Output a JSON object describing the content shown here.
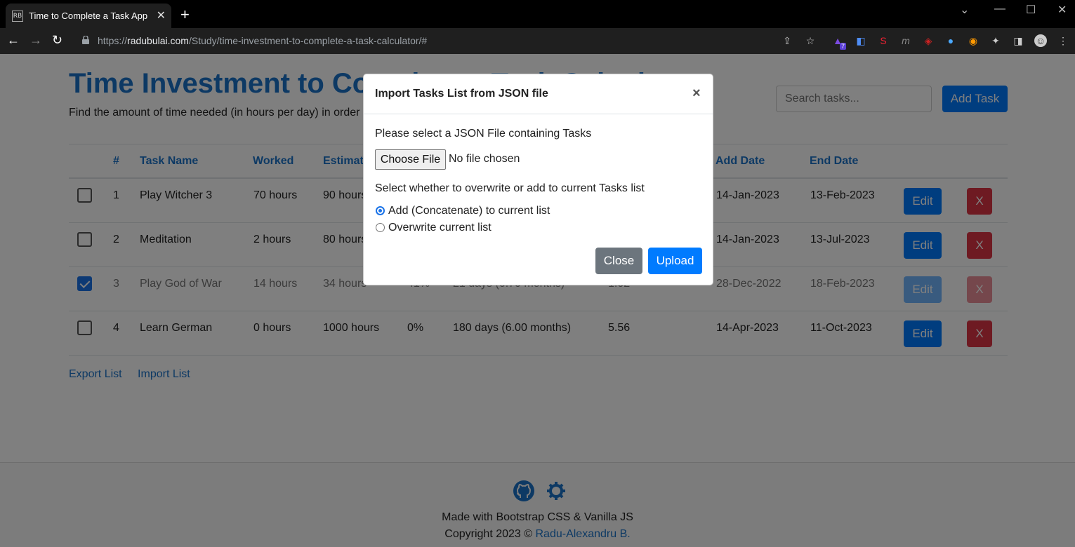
{
  "browser": {
    "tab_title": "Time to Complete a Task App",
    "favicon_text": "RB",
    "url_prefix": "https://",
    "url_domain": "radubulai.com",
    "url_path": "/Study/time-investment-to-complete-a-task-calculator/#",
    "extension_badge": "7"
  },
  "page": {
    "title": "Time Investment to Complete a Task Calculator",
    "subtitle": "Find the amount of time needed (in hours per day) in order",
    "search_placeholder": "Search tasks...",
    "add_task_label": "Add Task"
  },
  "table": {
    "headers": {
      "index": "#",
      "task_name": "Task Name",
      "worked": "Worked",
      "estimated": "Estimat",
      "add_date": "Add Date",
      "end_date": "End Date"
    },
    "rows": [
      {
        "checked": false,
        "index": "1",
        "name": "Play Witcher 3",
        "worked": "70 hours",
        "estimated": "90 hours",
        "progress": "",
        "duration": "",
        "hpd": "",
        "add_date": "14-Jan-2023",
        "end_date": "13-Feb-2023",
        "edit": "Edit",
        "delete": "X"
      },
      {
        "checked": false,
        "index": "2",
        "name": "Meditation",
        "worked": "2 hours",
        "estimated": "80 hours",
        "progress": "",
        "duration": "",
        "hpd": "",
        "add_date": "14-Jan-2023",
        "end_date": "13-Jul-2023",
        "edit": "Edit",
        "delete": "X"
      },
      {
        "checked": true,
        "index": "3",
        "name": "Play God of War",
        "worked": "14 hours",
        "estimated": "34 hours",
        "progress": "41%",
        "duration": "21 days (0.70 months)",
        "hpd": "1.02",
        "add_date": "28-Dec-2022",
        "end_date": "18-Feb-2023",
        "edit": "Edit",
        "delete": "X"
      },
      {
        "checked": false,
        "index": "4",
        "name": "Learn German",
        "worked": "0 hours",
        "estimated": "1000 hours",
        "progress": "0%",
        "duration": "180 days (6.00 months)",
        "hpd": "5.56",
        "add_date": "14-Apr-2023",
        "end_date": "11-Oct-2023",
        "edit": "Edit",
        "delete": "X"
      }
    ]
  },
  "links": {
    "export": "Export List",
    "import": "Import List"
  },
  "footer": {
    "made_with": "Made with Bootstrap CSS & Vanilla JS",
    "copyright": "Copyright 2023 © ",
    "author": "Radu-Alexandru B."
  },
  "modal": {
    "title": "Import Tasks List from JSON file",
    "close_x": "×",
    "select_label": "Please select a JSON File containing Tasks",
    "choose_file": "Choose File",
    "no_file": "No file chosen",
    "mode_label": "Select whether to overwrite or add to current Tasks list",
    "option_add": "Add (Concatenate) to current list",
    "option_overwrite": "Overwrite current list",
    "selected_option": "add",
    "close_button": "Close",
    "upload_button": "Upload"
  },
  "colors": {
    "primary": "#007bff",
    "danger": "#dc3545",
    "secondary": "#6c757d",
    "link": "#1a73c9"
  }
}
